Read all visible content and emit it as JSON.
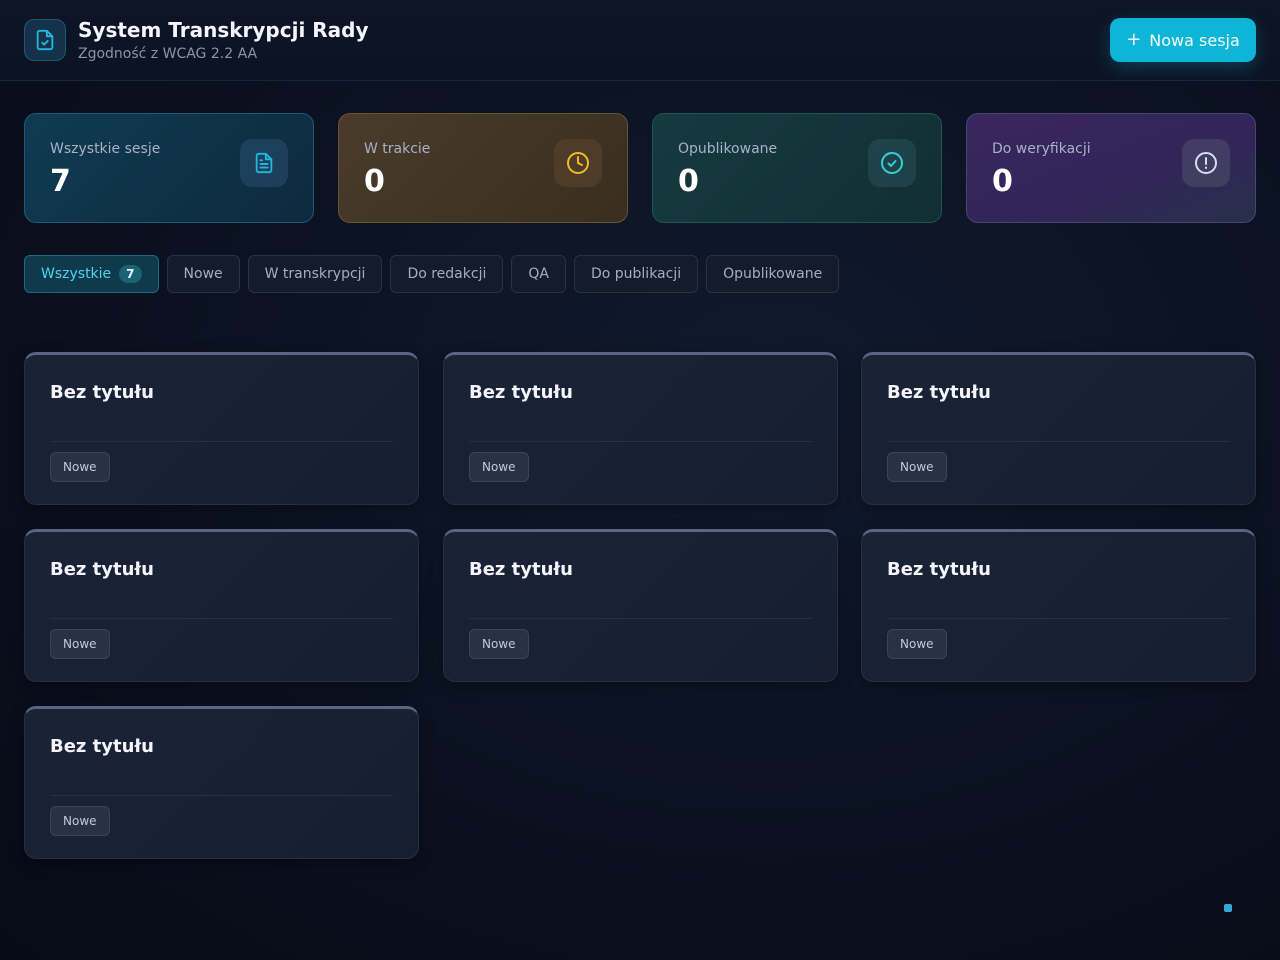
{
  "header": {
    "title": "System Transkrypcji Rady",
    "subtitle": "Zgodność z WCAG 2.2 AA",
    "new_session_label": "Nowa sesja"
  },
  "stats": [
    {
      "label": "Wszystkie sesje",
      "value": "7",
      "icon": "document-icon",
      "color": "#22b8e0"
    },
    {
      "label": "W trakcie",
      "value": "0",
      "icon": "clock-icon",
      "color": "#f5b829"
    },
    {
      "label": "Opublikowane",
      "value": "0",
      "icon": "check-circle-icon",
      "color": "#2fd0d6"
    },
    {
      "label": "Do weryfikacji",
      "value": "0",
      "icon": "alert-circle-icon",
      "color": "#d8dcf0"
    }
  ],
  "tabs": [
    {
      "label": "Wszystkie",
      "count": "7",
      "active": true
    },
    {
      "label": "Nowe"
    },
    {
      "label": "W transkrypcji"
    },
    {
      "label": "Do redakcji"
    },
    {
      "label": "QA"
    },
    {
      "label": "Do publikacji"
    },
    {
      "label": "Opublikowane"
    }
  ],
  "sessions": [
    {
      "title": "Bez tytułu",
      "status": "Nowe"
    },
    {
      "title": "Bez tytułu",
      "status": "Nowe"
    },
    {
      "title": "Bez tytułu",
      "status": "Nowe"
    },
    {
      "title": "Bez tytułu",
      "status": "Nowe"
    },
    {
      "title": "Bez tytułu",
      "status": "Nowe"
    },
    {
      "title": "Bez tytułu",
      "status": "Nowe"
    },
    {
      "title": "Bez tytułu",
      "status": "Nowe"
    }
  ]
}
